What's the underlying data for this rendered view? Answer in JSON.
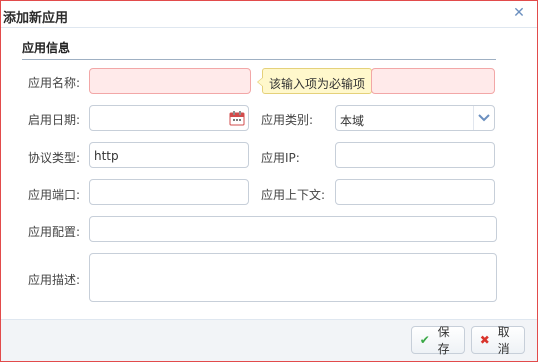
{
  "dialog": {
    "title": "添加新应用",
    "close_icon": "close-icon"
  },
  "section": {
    "title": "应用信息"
  },
  "form": {
    "app_name_label": "应用名称:",
    "app_name_value": "",
    "tooltip": "该输入项为必输项",
    "start_date_label": "启用日期:",
    "start_date_value": "",
    "app_type_label": "应用类别:",
    "app_type_value": "本域",
    "protocol_label": "协议类型:",
    "protocol_value": "http",
    "app_ip_label": "应用IP:",
    "app_ip_value": "",
    "app_port_label": "应用端口:",
    "app_port_value": "",
    "app_context_label": "应用上下文:",
    "app_context_value": "",
    "app_config_label": "应用配置:",
    "app_config_value": "",
    "app_desc_label": "应用描述:",
    "app_desc_value": ""
  },
  "footer": {
    "save_label": "保存",
    "cancel_label": "取消"
  },
  "colors": {
    "error_bg": "#ffeaea",
    "accent": "#6b8fbf",
    "save_icon": "#39a845",
    "cancel_icon": "#d9342b"
  }
}
